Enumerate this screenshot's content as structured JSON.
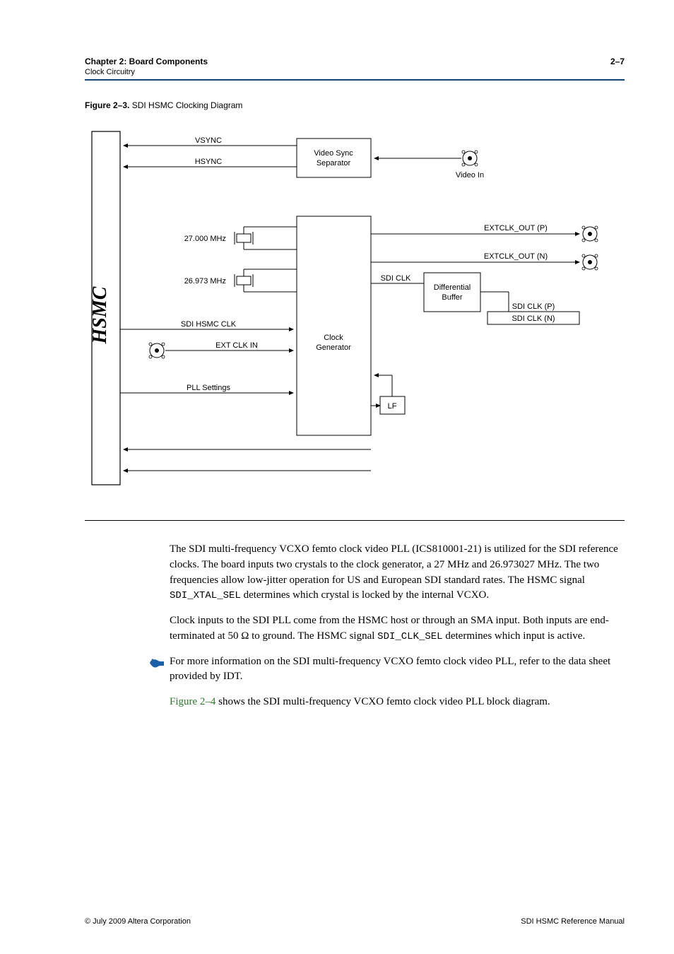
{
  "header": {
    "chapter": "Chapter 2: Board Components",
    "section": "Clock Circuitry",
    "page_number": "2–7"
  },
  "figure": {
    "number": "Figure 2–3.",
    "title": "SDI HSMC Clocking Diagram"
  },
  "diagram": {
    "vsync": "VSYNC",
    "hsync": "HSYNC",
    "video_sync_sep_l1": "Video Sync",
    "video_sync_sep_l2": "Separator",
    "video_in": "Video In",
    "xtal1": "27.000 MHz",
    "xtal2": "26.973 MHz",
    "sdi_hsmc_clk": "SDI HSMC CLK",
    "ext_clk_in": "EXT CLK IN",
    "pll_settings": "PLL Settings",
    "clock_gen_l1": "Clock",
    "clock_gen_l2": "Generator",
    "lf": "LF",
    "sdi_clk": "SDI CLK",
    "diff_buf_l1": "Differential",
    "diff_buf_l2": "Buffer",
    "extclk_out_p": "EXTCLK_OUT (P)",
    "extclk_out_n": "EXTCLK_OUT (N)",
    "sdi_clk_p": "SDI CLK (P)",
    "sdi_clk_n": "SDI CLK (N)",
    "hsmc_label": "HSMC"
  },
  "body": {
    "p1_a": "The SDI multi-frequency VCXO femto clock video PLL (ICS810001-21) is utilized for the SDI reference clocks. The board inputs two crystals to the clock generator, a 27 MHz and 26.973027 MHz. The two frequencies allow low-jitter operation for US and European SDI standard rates. The HSMC signal ",
    "p1_code": "SDI_XTAL_SEL",
    "p1_b": " determines which crystal is locked by the internal VCXO.",
    "p2_a": "Clock inputs to the SDI PLL come from the HSMC host or through an SMA input. Both inputs are end-terminated at 50 Ω to ground. The HSMC signal ",
    "p2_code": "SDI_CLK_SEL",
    "p2_b": " determines which input is active.",
    "info": "For more information on the SDI multi-frequency VCXO femto clock video PLL, refer to the data sheet provided by IDT.",
    "p3_link": "Figure 2–4",
    "p3_rest": " shows the SDI multi-frequency VCXO femto clock video PLL block diagram."
  },
  "footer": {
    "left": "© July 2009   Altera Corporation",
    "right": "SDI HSMC Reference Manual"
  }
}
